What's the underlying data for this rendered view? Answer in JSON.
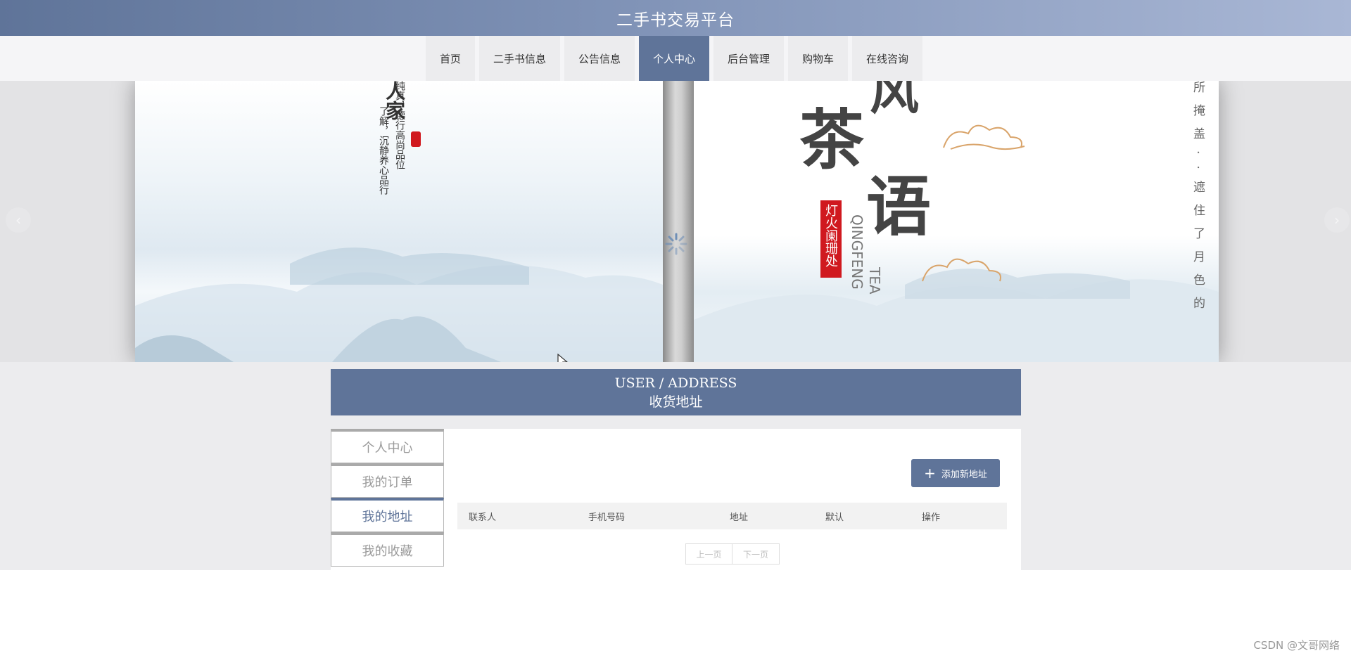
{
  "header": {
    "title": "二手书交易平台"
  },
  "nav": {
    "items": [
      {
        "label": "首页"
      },
      {
        "label": "二手书信息"
      },
      {
        "label": "公告信息"
      },
      {
        "label": "个人中心"
      },
      {
        "label": "后台管理"
      },
      {
        "label": "购物车"
      },
      {
        "label": "在线咨询"
      }
    ],
    "active_index": 3
  },
  "banner": {
    "left_page": {
      "vertical_line_1": "人家",
      "vertical_line_2": "纯真，德行高尚品位",
      "vertical_line_3": "了解，沉静养心品行"
    },
    "right_page": {
      "big_text_1": "风",
      "big_text_2": "茶",
      "big_text_3": "语",
      "seal": "灯火阑珊处",
      "latin_1": "QINGFENG",
      "latin_2": "TEA",
      "side_text": "所掩盖··遮住了月色的"
    },
    "prev_icon": "chevron-left-icon",
    "next_icon": "chevron-right-icon"
  },
  "section": {
    "title_en": "USER / ADDRESS",
    "title_cn": "收货地址"
  },
  "side_menu": {
    "items": [
      {
        "label": "个人中心"
      },
      {
        "label": "我的订单"
      },
      {
        "label": "我的地址"
      },
      {
        "label": "我的收藏"
      }
    ],
    "active_index": 2
  },
  "actions": {
    "add_address": "添加新地址",
    "add_icon": "plus-icon"
  },
  "table": {
    "columns": [
      "联系人",
      "手机号码",
      "地址",
      "默认",
      "操作"
    ],
    "rows": []
  },
  "pager": {
    "prev": "上一页",
    "next": "下一页"
  },
  "watermark": "CSDN @文哥网络",
  "colors": {
    "primary": "#5f7499",
    "background": "#ececee"
  }
}
